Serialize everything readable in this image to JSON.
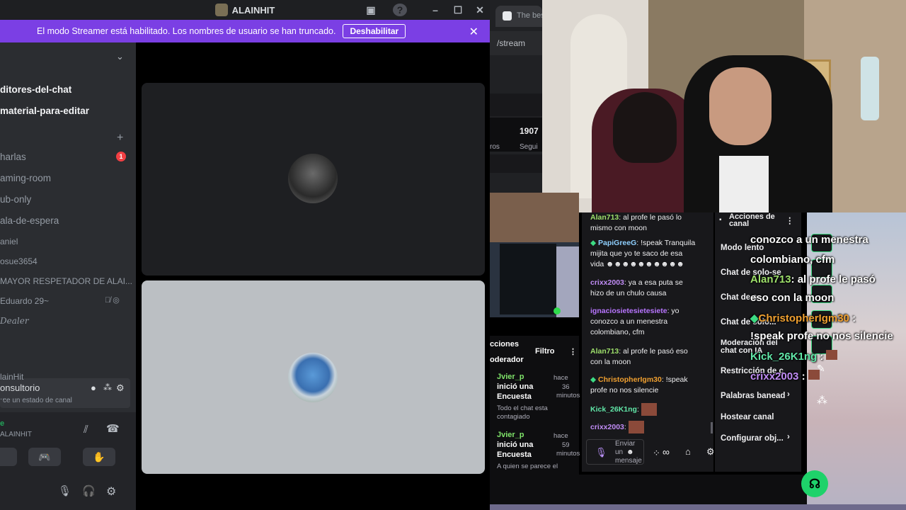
{
  "discord": {
    "window_title": "ALAINHIT",
    "banner_text": "El modo Streamer está habilitado. Los nombres de usuario se han truncado.",
    "banner_button": "Deshabilitar",
    "channels": [
      {
        "label": "ditores-del-chat"
      },
      {
        "label": "material-para-editar"
      },
      {
        "label": "harlas",
        "badge": "1"
      },
      {
        "label": "aming-room"
      },
      {
        "label": "ub-only"
      },
      {
        "label": "ala-de-espera"
      },
      {
        "label": "aniel"
      },
      {
        "label": "osue3654"
      },
      {
        "label": "MAYOR RESPETADOR DE ALAI..."
      },
      {
        "label": "Eduardo 29~"
      },
      {
        "label": "Dealer"
      },
      {
        "label": "onsultorio"
      },
      {
        "label": "ce un estado de canal"
      },
      {
        "label": "lainHit"
      },
      {
        "label": "..."
      }
    ],
    "user_panel": {
      "status": "e",
      "username": "ALAINHIT"
    }
  },
  "browser": {
    "tab_title": "The bes",
    "url": "/stream",
    "follower_count": "1907",
    "follower_label": "Segui",
    "partial_label": "ros"
  },
  "mod_panel": {
    "title_line1": "cciones",
    "title_line2": "oderador",
    "filter_label": "Filtro",
    "events": [
      {
        "user": "Jvier_p",
        "action1": "inició una",
        "action2": "Encuesta",
        "time1": "hace",
        "time2": "36",
        "time3": "minutos",
        "detail1": "Todo el chat esta",
        "detail2": "contagiado"
      },
      {
        "user": "Jvier_p",
        "action1": "inició una",
        "action2": "Encuesta",
        "time1": "hace",
        "time2": "59",
        "time3": "minutos",
        "detail1": "A quien se parece el",
        "detail2": ""
      }
    ]
  },
  "chat": {
    "messages": [
      {
        "user": "Alan713",
        "text": ": al profe le pasó lo",
        "text2": "mismo con moon",
        "color": "#9ee06b"
      },
      {
        "user": "PapiGreeG",
        "text": ": !speak Tranquila",
        "text2": "mijita que yo te saco de esa",
        "text3": "vida ☻☻☻☻☻☻☻☻☻☻",
        "color": "#8fd0ff"
      },
      {
        "user": "crixx2003",
        "text": ": ya a esa puta se",
        "text2": "hizo de un chulo causa",
        "color": "#c08cf5"
      },
      {
        "user": "ignaciosietesietesiete",
        "text": ": yo",
        "text2": "conozco a un menestra",
        "text3": "colombiano, cfm",
        "color": "#b875ff"
      },
      {
        "user": "Alan713",
        "text": ": al profe le pasó eso",
        "text2": "con la moon",
        "color": "#9ee06b"
      },
      {
        "user": "ChristopherIgm30",
        "text": ": !speak",
        "text2": "profe no nos silencie",
        "color": "#f0a030"
      },
      {
        "user": "Kick_26K1ng",
        "text": ":",
        "color": "#61e7a8"
      },
      {
        "user": "crixx2003",
        "text": ":",
        "color": "#c08cf5"
      }
    ],
    "input_placeholder1": "Enviar",
    "input_placeholder2": "un",
    "input_placeholder3": "mensaje"
  },
  "actions": {
    "title1": "Acciones de",
    "title2": "canal",
    "items": [
      {
        "label": "Modo lento"
      },
      {
        "label": "Chat de solo-se"
      },
      {
        "label": "Chat de s"
      },
      {
        "label": "Chat de solo..."
      },
      {
        "label": "Moderación del"
      },
      {
        "label": "chat con IA"
      },
      {
        "label": "Restricción de c"
      },
      {
        "label": "Palabras banead"
      },
      {
        "label": "Hostear canal"
      },
      {
        "label": "Configurar obj..."
      }
    ]
  },
  "overlay": {
    "lines": [
      {
        "text": "conozco a un menestra",
        "color": "#ffffff"
      },
      {
        "text": "colombiano, cfm",
        "color": "#ffffff"
      },
      {
        "user": "Alan713",
        "text": ": al profe le pasó",
        "color": "#9ee06b"
      },
      {
        "text": "eso con la moon",
        "color": "#ffffff"
      },
      {
        "user": "ChristopherIgm30",
        "text": " :",
        "color": "#f0a030"
      },
      {
        "text": "!speak profe no nos silencie",
        "color": "#ffffff"
      },
      {
        "user": "Kick_26K1ng",
        "text": " :",
        "color": "#61e7a8"
      },
      {
        "user": "crixx2003",
        "text": " :",
        "color": "#c08cf5"
      }
    ]
  }
}
